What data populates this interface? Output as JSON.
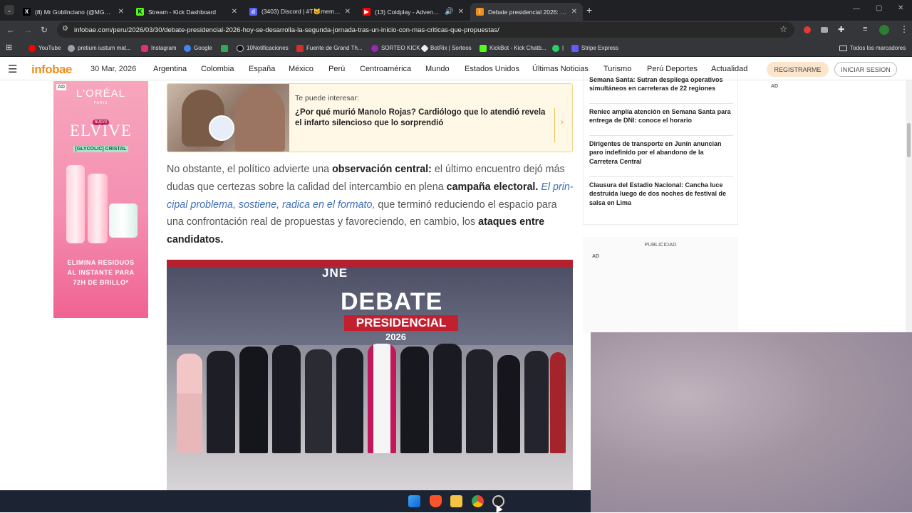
{
  "tabs": [
    {
      "title": "(8) Mr Goblinciano (@MGoblin",
      "icon": "x-icon"
    },
    {
      "title": "Stream - Kick Dashboard",
      "icon": "kick-icon"
    },
    {
      "title": "(3403) Discord | #T​🐱memes",
      "icon": "discord-icon"
    },
    {
      "title": "(13) Coldplay - Adventure O",
      "icon": "youtube-icon"
    },
    {
      "title": "Debate presidencial 2026: hoy",
      "icon": "infobae-icon"
    }
  ],
  "url": "infobae.com/peru/2026/03/30/debate-presidencial-2026-hoy-se-desarrolla-la-segunda-jornada-tras-un-inicio-con-mas-criticas-que-propuestas/",
  "bookmarks": [
    {
      "label": "YouTube",
      "color": "#ff0000"
    },
    {
      "label": "pretium iustum mat...",
      "color": "#9aa0a6"
    },
    {
      "label": "Instagram",
      "color": "#e1306c"
    },
    {
      "label": "Google",
      "color": "#4285f4"
    },
    {
      "label": "",
      "color": "#34a853"
    },
    {
      "label": "10Notificaciones",
      "color": "#ffffff"
    },
    {
      "label": "Fuente de Grand Th...",
      "color": "#d32f2f"
    },
    {
      "label": "SORTEO KICK",
      "color": "#9c27b0"
    },
    {
      "label": "BotRix | Sorteos",
      "color": "#ffffff"
    },
    {
      "label": "KickBot - Kick Chatb...",
      "color": "#53fc18"
    },
    {
      "label": "|",
      "color": "#25d366"
    },
    {
      "label": "Stripe Express",
      "color": "#635bff"
    }
  ],
  "bookmarks_folder": "Todos los marcadores",
  "site": {
    "logo": "infobae",
    "date": "30 Mar, 2026",
    "nav": [
      "Argentina",
      "Colombia",
      "España",
      "México",
      "Perú",
      "Centroamérica",
      "Mundo",
      "Estados Unidos",
      "Últimas Noticias",
      "Turismo",
      "Perú Deportes",
      "Actualidad"
    ],
    "register": "REGISTRARME",
    "login": "INICIAR SESION"
  },
  "ad_left": {
    "tag": "AD",
    "brand": "L'ORÉAL",
    "brand_sub": "PARIS",
    "nuevo": "NUEVO",
    "product": "ELVIVE",
    "line": "[GLYCOLIC] CRISTAL",
    "claim": "ELIMINA RESIDUOS AL INSTANTE PARA 72H DE BRILLO*"
  },
  "related": {
    "kicker": "Te puede interesar:",
    "title": "¿Por qué murió Manolo Rojas? Cardiólogo que lo atendió revela el infarto silencioso que lo sorprendió"
  },
  "article": {
    "p1": "No obstante, el político advierte una ",
    "b1": "observación central:",
    "p2": " el último encuentro dejó más dudas que certezas sobre la calidad del intercambio en plena ",
    "b2": "campaña electoral.",
    "i1": " El prin-cipal problema, sostiene, radica en el formato,",
    "p3": " que terminó reduciendo el espacio para una confrontación real de propuestas y favoreciendo, en cambio, los ",
    "b3": "ataques entre candidatos."
  },
  "photo": {
    "jne": "JNE",
    "debate": "DEBATE",
    "presidencial": "PRESIDENCIAL",
    "year": "2026"
  },
  "right_news": [
    "Semana Santa: Sutran despliega operativos simultáneos en carreteras de 22 regiones",
    "Reniec amplía atención en Semana Santa para entrega de DNI: conoce el horario",
    "Dirigentes de transporte en Junín anuncian paro indefinido por el abandono de la Carretera Central",
    "Clausura del Estadio Nacional: Cancha luce destruida luego de dos noches de festival de salsa en Lima"
  ],
  "right_ad_tag": "AD",
  "publicidad": "PUBLICIDAD",
  "pub_ad_tag": "AD"
}
